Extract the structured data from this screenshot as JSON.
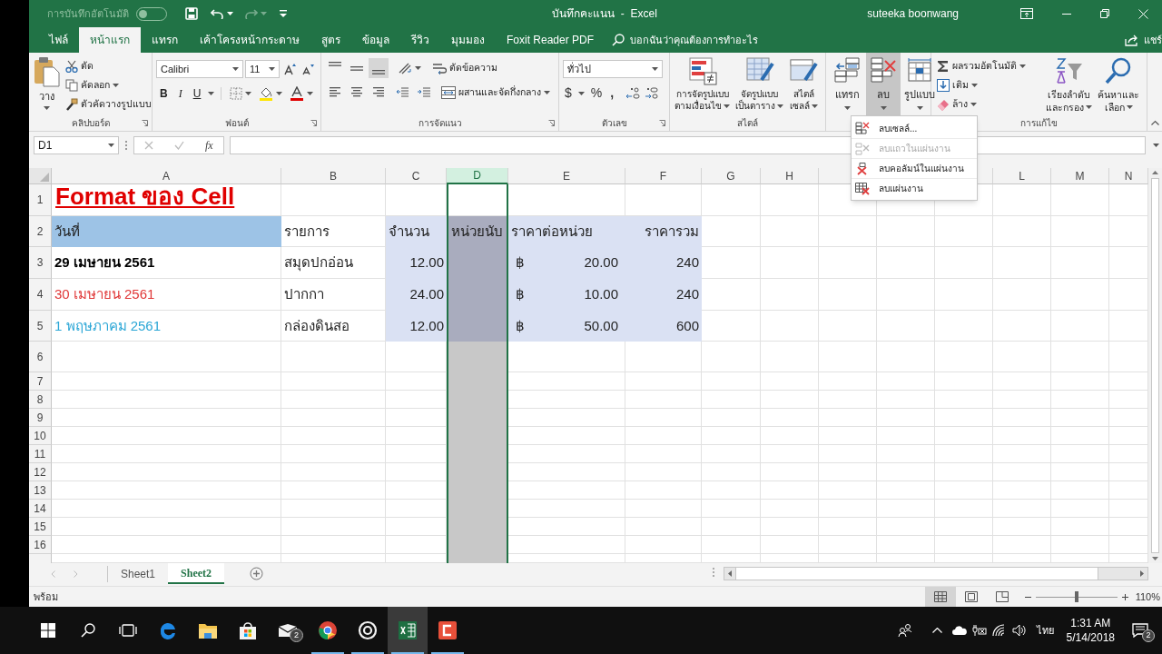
{
  "window": {
    "autosave": {
      "label": "การบันทึกอัตโนมัติ",
      "on": false
    },
    "title": "บันทึกคะแนน  -  Excel",
    "user": "suteeka boonwang"
  },
  "ribbon_tabs": [
    {
      "label": "ไฟล์",
      "selected": false
    },
    {
      "label": "หน้าแรก",
      "selected": true
    },
    {
      "label": "แทรก",
      "selected": false
    },
    {
      "label": "เค้าโครงหน้ากระดาษ",
      "selected": false
    },
    {
      "label": "สูตร",
      "selected": false
    },
    {
      "label": "ข้อมูล",
      "selected": false
    },
    {
      "label": "รีวิว",
      "selected": false
    },
    {
      "label": "มุมมอง",
      "selected": false
    },
    {
      "label": "Foxit Reader PDF",
      "selected": false
    }
  ],
  "tell_me": {
    "placeholder": "บอกฉันว่าคุณต้องการทำอะไร"
  },
  "share": "แชร์",
  "ribbon": {
    "clipboard": {
      "label": "คลิปบอร์ด",
      "paste": "วาง",
      "cut": "ตัด",
      "copy": "คัดลอก",
      "format_painter": "ตัวคัดวางรูปแบบ"
    },
    "font": {
      "label": "ฟอนต์",
      "font_name": "Calibri",
      "font_size": "11",
      "bold": "B",
      "italic": "I",
      "underline": "U"
    },
    "alignment": {
      "label": "การจัดแนว",
      "wrap_text": "ตัดข้อความ",
      "merge": "ผสานและจัดกึ่งกลาง"
    },
    "number": {
      "label": "ตัวเลข",
      "format": "ทั่วไป",
      "currency": "$",
      "percent": "%",
      "comma": ","
    },
    "styles": {
      "label": "สไตล์",
      "buttons": [
        {
          "kind": "conditional",
          "lines": [
            "การจัดรูปแบบ",
            "ตามเงื่อนไข"
          ]
        },
        {
          "kind": "table",
          "lines": [
            "จัดรูปแบบ",
            "เป็นตาราง"
          ]
        },
        {
          "kind": "cell",
          "lines": [
            "สไตล์",
            "เซลล์"
          ]
        }
      ]
    },
    "cells": {
      "buttons": [
        {
          "kind": "insert",
          "label": "แทรก",
          "pressed": false
        },
        {
          "kind": "delete",
          "label": "ลบ",
          "pressed": true
        },
        {
          "kind": "format",
          "label": "รูปแบบ",
          "pressed": false
        }
      ]
    },
    "editing": {
      "label": "การแก้ไข",
      "autosum": "ผลรวมอัตโนมัติ",
      "fill": "เติม",
      "clear": "ล้าง",
      "sort": [
        "เรียงลำดับ",
        "และกรอง"
      ],
      "find": [
        "ค้นหาและ",
        "เลือก"
      ]
    }
  },
  "delete_menu": [
    {
      "kind": "cells",
      "label": "ลบเซลล์...",
      "disabled": false
    },
    {
      "kind": "rows",
      "label": "ลบแถวในแผ่นงาน",
      "disabled": true
    },
    {
      "kind": "columns",
      "label": "ลบคอลัมน์ในแผ่นงาน",
      "disabled": false
    },
    {
      "kind": "sheet",
      "label": "ลบแผ่นงาน",
      "disabled": false
    }
  ],
  "formula_bar": {
    "name_box": "D1",
    "function_label": "fx"
  },
  "columns": [
    {
      "label": "A",
      "selected": false
    },
    {
      "label": "B",
      "selected": false
    },
    {
      "label": "C",
      "selected": false
    },
    {
      "label": "D",
      "selected": true
    },
    {
      "label": "E",
      "selected": false
    },
    {
      "label": "F",
      "selected": false
    },
    {
      "label": "G",
      "selected": false
    },
    {
      "label": "H",
      "selected": false
    },
    {
      "selected": false
    },
    {},
    {
      "selected": false
    },
    {
      "label": "L",
      "selected": false
    },
    {
      "label": "M",
      "selected": false
    },
    {
      "label": "N",
      "selected": false
    }
  ],
  "rows": [
    {
      "number": "1",
      "cells": [
        {
          "kind": "title",
          "text": "Format ของ Cell",
          "color": "#e00000"
        }
      ]
    },
    {
      "number": "2",
      "cells": [
        {
          "kind": "text",
          "text": "วันที่",
          "highlighted": true
        },
        {
          "kind": "text",
          "text": "รายการ"
        },
        {
          "kind": "text",
          "text": "จำนวน",
          "shaded": true
        },
        {
          "kind": "text",
          "text": "หน่วยนับ",
          "shaded": true
        },
        {
          "kind": "text",
          "text": "ราคาต่อหน่วย",
          "shaded": true
        },
        {
          "kind": "number",
          "text": "ราคารวม",
          "shaded": true
        }
      ]
    },
    {
      "number": "3",
      "cells": [
        {
          "kind": "text",
          "text": "29 เมษายน 2561",
          "bold": true,
          "color": "#000000"
        },
        {
          "kind": "text",
          "text": "สมุดปกอ่อน"
        },
        {
          "kind": "number",
          "text": "12.00",
          "shaded": true
        },
        {
          "shaded": true
        },
        {
          "kind": "currency",
          "symbol": "฿",
          "text": "20.00",
          "shaded": true
        },
        {
          "kind": "number",
          "text": "240",
          "shaded": true
        }
      ]
    },
    {
      "number": "4",
      "cells": [
        {
          "kind": "text",
          "text": "30 เมษายน 2561",
          "bold": false,
          "color": "#e03838"
        },
        {
          "kind": "text",
          "text": "ปากกา"
        },
        {
          "kind": "number",
          "text": "24.00",
          "shaded": true
        },
        {
          "shaded": true
        },
        {
          "kind": "currency",
          "symbol": "฿",
          "text": "10.00",
          "shaded": true
        },
        {
          "kind": "number",
          "text": "240",
          "shaded": true
        }
      ]
    },
    {
      "number": "5",
      "cells": [
        {
          "kind": "text",
          "text": "1 พฤษภาคม 2561",
          "bold": false,
          "color": "#2aa6d6"
        },
        {
          "kind": "text",
          "text": "กล่องดินสอ"
        },
        {
          "kind": "number",
          "text": "12.00",
          "shaded": true
        },
        {
          "shaded": true
        },
        {
          "kind": "currency",
          "symbol": "฿",
          "text": "50.00",
          "shaded": true
        },
        {
          "kind": "number",
          "text": "600",
          "shaded": true
        }
      ]
    },
    {
      "number": "6"
    },
    {
      "number": "7"
    },
    {
      "number": "8"
    },
    {
      "number": "9"
    },
    {
      "number": "10"
    },
    {
      "number": "11"
    },
    {
      "number": "12"
    },
    {
      "number": "13"
    },
    {
      "number": "14"
    },
    {
      "number": "15"
    },
    {
      "number": "16"
    }
  ],
  "sheet_tabs": [
    {
      "label": "Sheet1",
      "selected": false
    },
    {
      "label": "Sheet2",
      "selected": true
    }
  ],
  "status_bar": {
    "status": "พร้อม",
    "views": [
      {
        "kind": "normal",
        "selected": true
      },
      {
        "kind": "page_layout",
        "selected": false
      },
      {
        "kind": "page_break",
        "selected": false
      }
    ],
    "zoom": {
      "level": 0.5,
      "reading": "110%"
    }
  },
  "taskbar": {
    "apps": [
      {
        "kind": "edge",
        "running": false,
        "active": false
      },
      {
        "kind": "explorer",
        "running": false,
        "active": false
      },
      {
        "kind": "store",
        "running": false,
        "active": false
      },
      {
        "kind": "mail",
        "running": false,
        "active": false,
        "badge": "2"
      },
      {
        "kind": "chrome",
        "running": true,
        "active": false
      },
      {
        "kind": "target",
        "running": true,
        "active": false
      },
      {
        "kind": "excel",
        "running": true,
        "active": true
      },
      {
        "kind": "red",
        "running": true,
        "active": false
      }
    ],
    "language": "ไทย",
    "time": "1:31 AM",
    "date": "5/14/2018",
    "notification_badge": "2"
  }
}
